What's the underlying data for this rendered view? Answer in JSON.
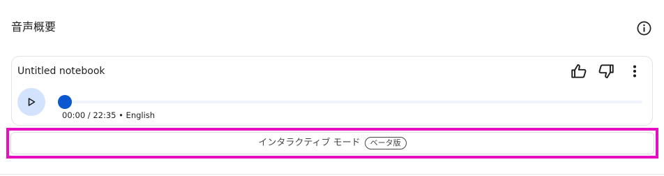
{
  "section": {
    "title": "音声概要",
    "info_icon": "info-icon"
  },
  "player": {
    "notebook_title": "Untitled notebook",
    "icons": {
      "thumb_up": "thumb-up-icon",
      "thumb_down": "thumb-down-icon",
      "more": "more-vert-icon",
      "play": "play-icon"
    },
    "current_time": "00:00",
    "duration": "22:35",
    "time_text": "00:00 / 22:35 • English",
    "language": "English",
    "progress": 0
  },
  "interactive_mode": {
    "label": "インタラクティブ モード",
    "badge": "ベータ版"
  },
  "colors": {
    "accent": "#0b57d0",
    "play_bg": "#d3e3fd",
    "highlight": "#e60fbf"
  }
}
